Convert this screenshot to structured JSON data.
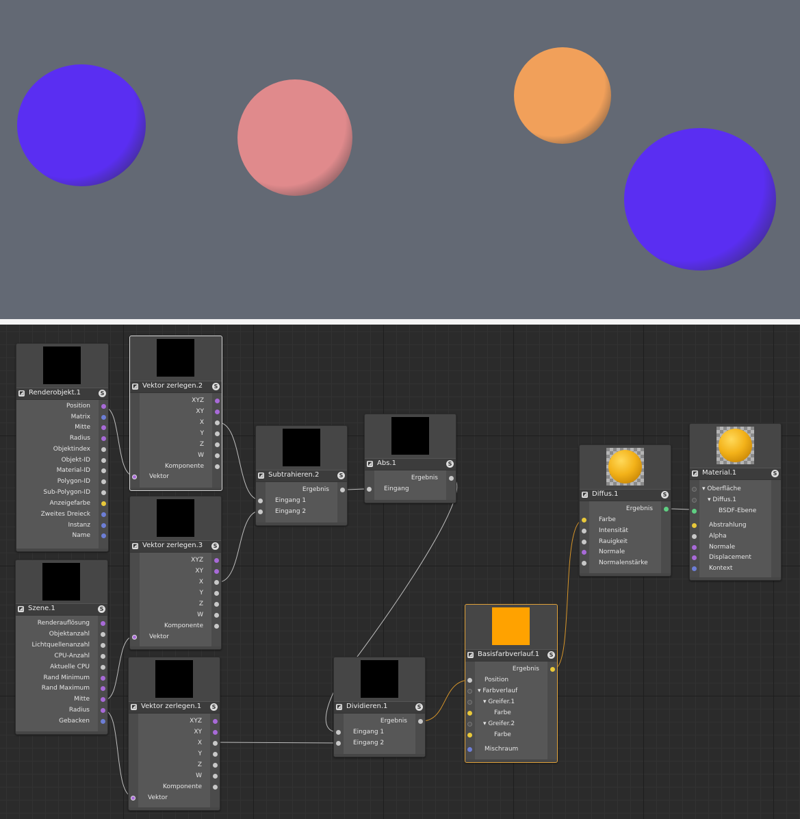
{
  "viewport": {
    "spheres": [
      {
        "name": "sphere-1",
        "color": "#5a2ef2"
      },
      {
        "name": "sphere-2",
        "color": "#e08a8c"
      },
      {
        "name": "sphere-3",
        "color": "#f1a05a"
      },
      {
        "name": "sphere-4",
        "color": "#5a2ef2"
      }
    ]
  },
  "colors": {
    "port_purple": "#a86ad8",
    "port_blue": "#6d7ed6",
    "port_white": "#c8c8c8",
    "port_yellow": "#e8c83a",
    "port_green": "#5fcf82",
    "wire": "#bfbfbf",
    "wire_orange": "#d8962a",
    "gradient_preview": "#ffa200"
  },
  "nodes": {
    "renderobjekt": {
      "title": "Renderobjekt.1",
      "ports": [
        "Position",
        "Matrix",
        "Mitte",
        "Radius",
        "Objektindex",
        "Objekt-ID",
        "Material-ID",
        "Polygon-ID",
        "Sub-Polygon-ID",
        "Anzeigefarbe",
        "Zweites Dreieck",
        "Instanz",
        "Name"
      ]
    },
    "szene": {
      "title": "Szene.1",
      "ports": [
        "Renderauflösung",
        "Objektanzahl",
        "Lichtquellenanzahl",
        "CPU-Anzahl",
        "Aktuelle CPU",
        "Rand Minimum",
        "Rand Maximum",
        "Mitte",
        "Radius",
        "Gebacken"
      ]
    },
    "vz2": {
      "title": "Vektor zerlegen.2",
      "outputs": [
        "XYZ",
        "XY",
        "X",
        "Y",
        "Z",
        "W",
        "Komponente"
      ],
      "input": "Vektor"
    },
    "vz3": {
      "title": "Vektor zerlegen.3",
      "outputs": [
        "XYZ",
        "XY",
        "X",
        "Y",
        "Z",
        "W",
        "Komponente"
      ],
      "input": "Vektor"
    },
    "vz1": {
      "title": "Vektor zerlegen.1",
      "outputs": [
        "XYZ",
        "XY",
        "X",
        "Y",
        "Z",
        "W",
        "Komponente"
      ],
      "input": "Vektor"
    },
    "subtrahieren": {
      "title": "Subtrahieren.2",
      "output": "Ergebnis",
      "inputs": [
        "Eingang 1",
        "Eingang 2"
      ]
    },
    "abs": {
      "title": "Abs.1",
      "output": "Ergebnis",
      "input": "Eingang"
    },
    "dividieren": {
      "title": "Dividieren.1",
      "output": "Ergebnis",
      "inputs": [
        "Eingang 1",
        "Eingang 2"
      ]
    },
    "basisfarbverlauf": {
      "title": "Basisfarbverlauf.1",
      "output": "Ergebnis",
      "inputs": [
        "Position",
        "Farbverlauf",
        "Greifer.1",
        "Farbe",
        "Greifer.2",
        "Farbe",
        "Mischraum"
      ]
    },
    "diffus": {
      "title": "Diffus.1",
      "output": "Ergebnis",
      "inputs": [
        "Farbe",
        "Intensität",
        "Rauigkeit",
        "Normale",
        "Normalenstärke"
      ]
    },
    "material": {
      "title": "Material.1",
      "tree": [
        "Oberfläche",
        "Diffus.1",
        "BSDF-Ebene"
      ],
      "inputs": [
        "Abstrahlung",
        "Alpha",
        "Normale",
        "Displacement",
        "Kontext"
      ]
    }
  }
}
